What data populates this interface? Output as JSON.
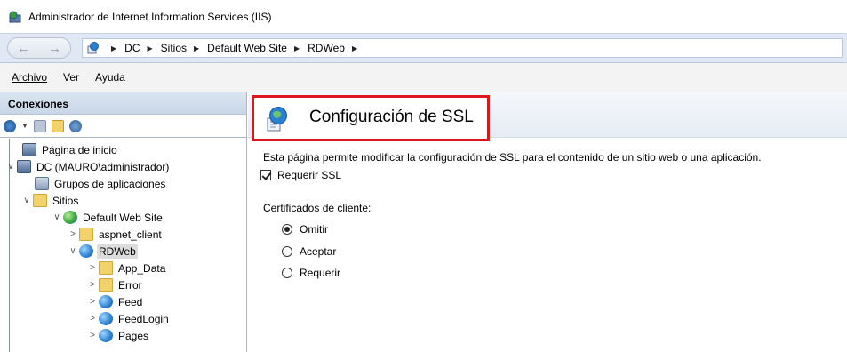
{
  "window": {
    "title": "Administrador de Internet Information Services (IIS)"
  },
  "nav": {
    "back_icon": "back-arrow-icon",
    "forward_icon": "forward-arrow-icon",
    "breadcrumb": [
      "DC",
      "Sitios",
      "Default Web Site",
      "RDWeb"
    ]
  },
  "menu": {
    "items": [
      "Archivo",
      "Ver",
      "Ayuda"
    ]
  },
  "connections": {
    "header": "Conexiones",
    "tree": [
      {
        "label": "Página de inicio",
        "icon": "start-page-icon"
      },
      {
        "label": "DC (MAURO\\administrador)",
        "icon": "server-icon",
        "expanded": true
      },
      {
        "label": "Grupos de aplicaciones",
        "icon": "app-pool-icon"
      },
      {
        "label": "Sitios",
        "icon": "sites-folder-icon",
        "expanded": true
      },
      {
        "label": "Default Web Site",
        "icon": "website-globe-icon",
        "expanded": true
      },
      {
        "label": "aspnet_client",
        "icon": "folder-icon"
      },
      {
        "label": "RDWeb",
        "icon": "web-app-icon",
        "expanded": true,
        "selected": true
      },
      {
        "label": "App_Data",
        "icon": "folder-icon"
      },
      {
        "label": "Error",
        "icon": "folder-icon"
      },
      {
        "label": "Feed",
        "icon": "web-app-icon"
      },
      {
        "label": "FeedLogin",
        "icon": "web-app-icon"
      },
      {
        "label": "Pages",
        "icon": "web-app-icon"
      }
    ]
  },
  "ssl": {
    "title": "Configuración de SSL",
    "description": "Esta página permite modificar la configuración de SSL para el contenido de un sitio web o una aplicación.",
    "require_ssl_label": "Requerir SSL",
    "require_ssl_checked": true,
    "client_certs_label": "Certificados de cliente:",
    "options": [
      {
        "label": "Omitir",
        "selected": true
      },
      {
        "label": "Aceptar",
        "selected": false
      },
      {
        "label": "Requerir",
        "selected": false
      }
    ],
    "highlight_color": "#e0141c"
  }
}
